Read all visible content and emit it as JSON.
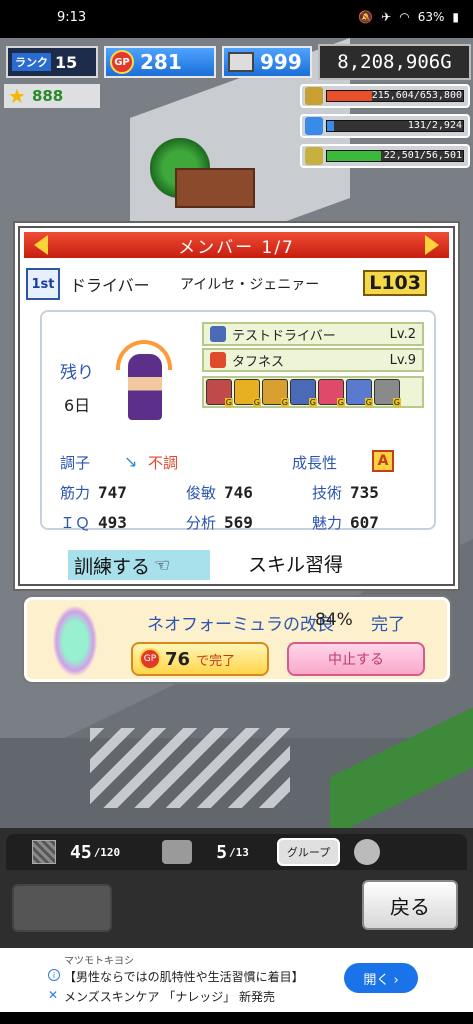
{
  "status_bar": {
    "time": "9:13",
    "battery": "63%"
  },
  "hud": {
    "rank_label": "ランク",
    "rank_value": "15",
    "gp_icon": "GP",
    "gp_value": "281",
    "pc_value": "999",
    "money": "8,208,906G",
    "stars": "888",
    "resources": [
      {
        "name": "money-resource",
        "value": "215,604/653,800",
        "fill": 0.33,
        "color": "#e8502a"
      },
      {
        "name": "water-resource",
        "value": "131/2,924",
        "fill": 0.05,
        "color": "#3a8ae8"
      },
      {
        "name": "wheat-resource",
        "value": "22,501/56,501",
        "fill": 0.4,
        "color": "#3ab83a"
      }
    ]
  },
  "member": {
    "header": "メンバー 1/7",
    "rank_badge": "1st",
    "role": "ドライバー",
    "name": "アイルセ・ジェニァー",
    "level": "L103",
    "remaining_label": "残り",
    "remaining_days": "6日",
    "skills": [
      {
        "name": "テストドライバー",
        "level": "Lv.2",
        "icon_color": "#4a6ab8"
      },
      {
        "name": "タフネス",
        "level": "Lv.9",
        "icon_color": "#e04a2a"
      }
    ],
    "equipment_count": 7,
    "condition_label": "調子",
    "condition_value": "不調",
    "growth_label": "成長性",
    "growth_value": "A",
    "stats": [
      {
        "label": "筋力",
        "value": "747"
      },
      {
        "label": "俊敏",
        "value": "746"
      },
      {
        "label": "技術",
        "value": "735"
      },
      {
        "label": "ＩＱ",
        "value": "493"
      },
      {
        "label": "分析",
        "value": "569"
      },
      {
        "label": "魅力",
        "value": "607"
      }
    ],
    "train_label": "訓練する",
    "skill_learn_label": "スキル習得"
  },
  "research": {
    "title": "ネオフォーミュラの改良",
    "percent": "84%",
    "status": "完了",
    "cost": "76",
    "complete_label": "で完了",
    "cancel_label": "中止する"
  },
  "bottom": {
    "tiles": "45",
    "tiles_max": "/120",
    "garage": "5",
    "garage_max": "/13",
    "group_label": "グループ",
    "back_label": "戻る"
  },
  "ad": {
    "advertiser": "マツモトキヨシ",
    "line1": "【男性ならではの肌特性や生活習慣に着目】",
    "line2": "メンズスキンケア 「ナレッジ」 新発売",
    "open_label": "開く ›"
  }
}
